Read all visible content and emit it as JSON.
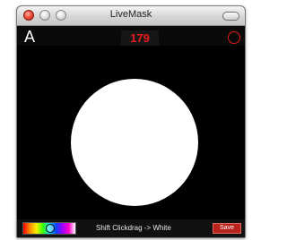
{
  "window": {
    "title": "LiveMask"
  },
  "toolbar": {
    "mode_letter": "A",
    "counter": "179",
    "shape_toggle_icon": "circle-outline-icon"
  },
  "canvas": {
    "background": "#000000",
    "mask_shape": "circle",
    "mask_color": "#ffffff"
  },
  "bottom": {
    "hint": "Shift Clickdrag -> White",
    "save_label": "Save",
    "color_picker_icon": "color-gradient-icon"
  },
  "colors": {
    "accent_red": "#e01b1b",
    "save_button": "#b8231b"
  }
}
